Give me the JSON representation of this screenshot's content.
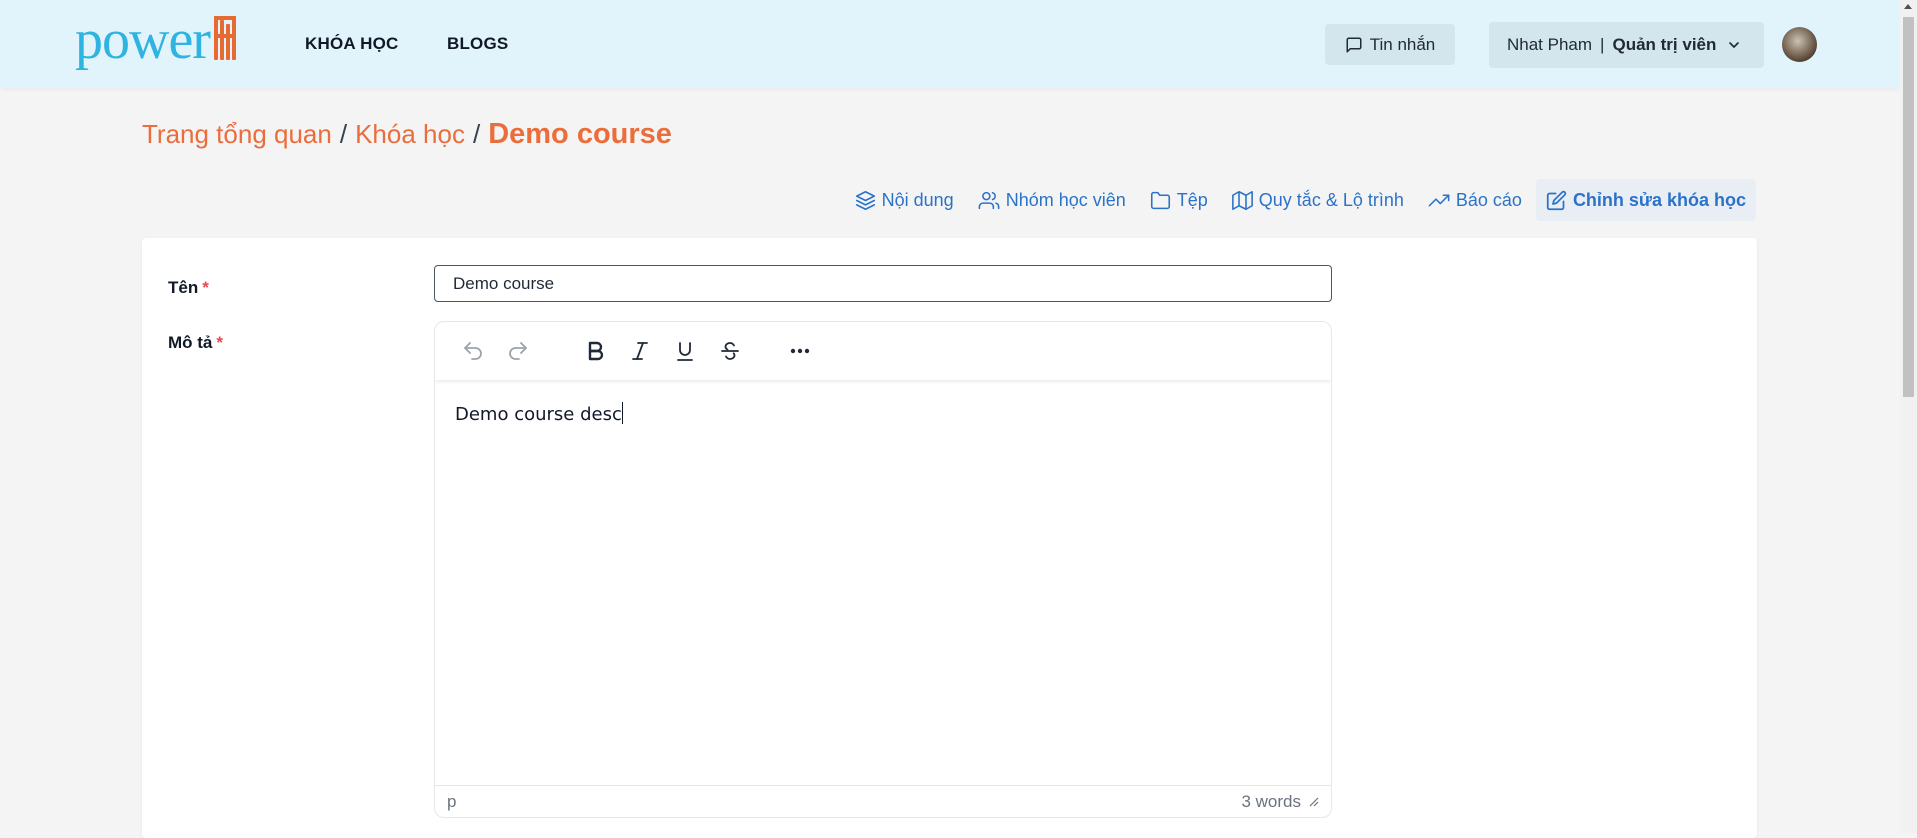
{
  "header": {
    "logo_text": "power",
    "logo_mark": "5",
    "nav": [
      {
        "label": "KHÓA HỌC"
      },
      {
        "label": "BLOGS"
      }
    ],
    "messages_label": "Tin nhắn",
    "user": {
      "name": "Nhat Pham",
      "separator": "|",
      "role": "Quản trị viên"
    }
  },
  "breadcrumb": {
    "items": [
      "Trang tổng quan",
      "Khóa học"
    ],
    "separator": "/",
    "current": "Demo course"
  },
  "tabs": [
    {
      "label": "Nội dung",
      "icon": "layers-icon"
    },
    {
      "label": "Nhóm học viên",
      "icon": "users-icon"
    },
    {
      "label": "Tệp",
      "icon": "folder-icon"
    },
    {
      "label": "Quy tắc & Lộ trình",
      "icon": "map-icon"
    },
    {
      "label": "Báo cáo",
      "icon": "trending-up-icon"
    },
    {
      "label": "Chỉnh sửa khóa học",
      "icon": "edit-icon",
      "active": true
    }
  ],
  "form": {
    "name_label": "Tên",
    "required_mark": "*",
    "name_value": "Demo course",
    "description_label": "Mô tả",
    "description_value": "Demo course desc"
  },
  "editor": {
    "toolbar": [
      "undo-icon",
      "redo-icon",
      "bold-icon",
      "italic-icon",
      "underline-icon",
      "strikethrough-icon",
      "more-icon"
    ],
    "status_element": "p",
    "word_count": "3 words"
  },
  "colors": {
    "header_bg": "#e1f3fb",
    "accent_orange": "#ec6d3c",
    "link_blue": "#2b73c9",
    "page_bg": "#f4f4f4"
  }
}
